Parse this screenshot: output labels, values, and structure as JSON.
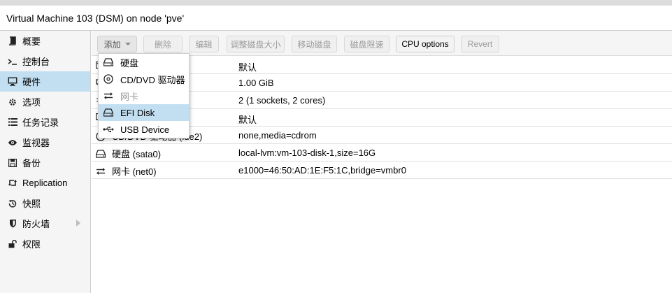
{
  "window": {
    "title": "Virtual Machine 103 (DSM) on node 'pve'"
  },
  "sidebar": {
    "items": [
      {
        "label": "概要",
        "icon": "book-icon"
      },
      {
        "label": "控制台",
        "icon": "terminal-icon"
      },
      {
        "label": "硬件",
        "icon": "desktop-icon",
        "active": true
      },
      {
        "label": "选项",
        "icon": "gear-icon"
      },
      {
        "label": "任务记录",
        "icon": "list-icon"
      },
      {
        "label": "监视器",
        "icon": "eye-icon"
      },
      {
        "label": "备份",
        "icon": "floppy-icon"
      },
      {
        "label": "Replication",
        "icon": "retweet-icon"
      },
      {
        "label": "快照",
        "icon": "history-icon"
      },
      {
        "label": "防火墙",
        "icon": "shield-icon",
        "expandable": true
      },
      {
        "label": "权限",
        "icon": "unlock-icon"
      }
    ]
  },
  "toolbar": {
    "add": "添加",
    "remove": "删除",
    "edit": "编辑",
    "resize": "调整磁盘大小",
    "move": "移动磁盘",
    "throttle": "磁盘限速",
    "cpu_options": "CPU options",
    "revert": "Revert"
  },
  "hardware_rows": [
    {
      "name": "",
      "value": "默认",
      "icon": "keyboard-icon"
    },
    {
      "name": "",
      "value": "1.00 GiB",
      "icon": "memory-icon"
    },
    {
      "name": "",
      "value": "2 (1 sockets, 2 cores)",
      "icon": "cpu-icon"
    },
    {
      "name": "",
      "value": "默认",
      "icon": "display-icon"
    },
    {
      "name": "CD/DVD 驱动器 (ide2)",
      "value": "none,media=cdrom",
      "icon": "cdrom-icon"
    },
    {
      "name": "硬盘 (sata0)",
      "value": "local-lvm:vm-103-disk-1,size=16G",
      "icon": "harddisk-icon"
    },
    {
      "name": "网卡 (net0)",
      "value": "e1000=46:50:AD:1E:F5:1C,bridge=vmbr0",
      "icon": "network-icon"
    }
  ],
  "add_menu": {
    "items": [
      {
        "label": "硬盘",
        "icon": "harddisk-icon"
      },
      {
        "label": "CD/DVD 驱动器",
        "icon": "cdrom-icon"
      },
      {
        "label": "网卡",
        "icon": "network-icon",
        "disabled": true
      },
      {
        "label": "EFI Disk",
        "icon": "harddisk-icon",
        "highlighted": true
      },
      {
        "label": "USB Device",
        "icon": "usb-icon"
      }
    ]
  },
  "colors": {
    "selection": "#c2dff2",
    "sidebar_bg": "#f5f5f5",
    "toolbar_bg": "#f5f5f5",
    "disabled_text": "#9a9a9a"
  }
}
